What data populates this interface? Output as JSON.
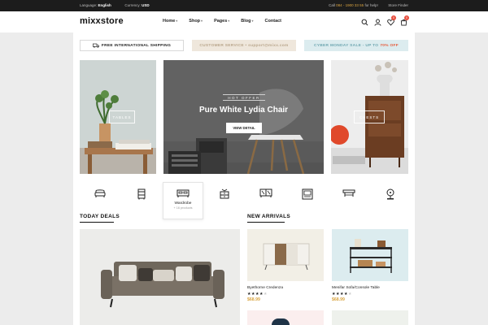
{
  "topbar": {
    "language_label": "Language:",
    "language_value": "English",
    "currency_label": "Currency:",
    "currency_value": "USD",
    "call_prefix": "Call",
    "phone": "084 - 1900 33 55",
    "call_suffix": "for help!",
    "store_finder": "Store Finder"
  },
  "header": {
    "logo": "mixxstore",
    "nav": [
      {
        "label": "Home",
        "caret": true
      },
      {
        "label": "Shop",
        "caret": true
      },
      {
        "label": "Pages",
        "caret": true
      },
      {
        "label": "Blog",
        "caret": true
      },
      {
        "label": "Contact",
        "caret": false
      }
    ],
    "icons": [
      "search-icon",
      "user-icon",
      "heart-icon",
      "cart-icon"
    ],
    "wishlist_count": "0",
    "cart_count": "0"
  },
  "promos": {
    "shipping": "FREE INTERNATIONAL SHIPPING",
    "service": "CUSTOMER SERVICE • support@mixx.com",
    "sale_prefix": "CYBER MONDAY SALE - UP TO",
    "sale_highlight": "70% OFF"
  },
  "banners": {
    "left_label": "TABLES",
    "center_tag": "HOT OFFER",
    "center_title": "Pure White Lydia Chair",
    "center_button": "VIEW DETAIL",
    "right_label": "CHESTS"
  },
  "categories": [
    {
      "icon": "armchair-icon"
    },
    {
      "icon": "cabinet-icon"
    },
    {
      "icon": "bed-icon",
      "name": "Wardrobe",
      "count": "+ 16 products",
      "active": true
    },
    {
      "icon": "dresser-icon"
    },
    {
      "icon": "sideboard-icon"
    },
    {
      "icon": "tv-stand-icon"
    },
    {
      "icon": "table-icon"
    },
    {
      "icon": "lamp-icon"
    }
  ],
  "sections": {
    "today_deals": "TODAY DEALS",
    "new_arrivals": "NEW ARRIVALS"
  },
  "products": [
    {
      "name": "Byethorne Credenza",
      "rating": 4,
      "price": "$68.99"
    },
    {
      "name": "Menifar Sofa/Console Table",
      "rating": 4,
      "price": "$68.99"
    }
  ],
  "colors": {
    "accent_gold": "#d9a441",
    "sale_red": "#e65a3a",
    "topbar_bg": "#1c1c1c"
  }
}
